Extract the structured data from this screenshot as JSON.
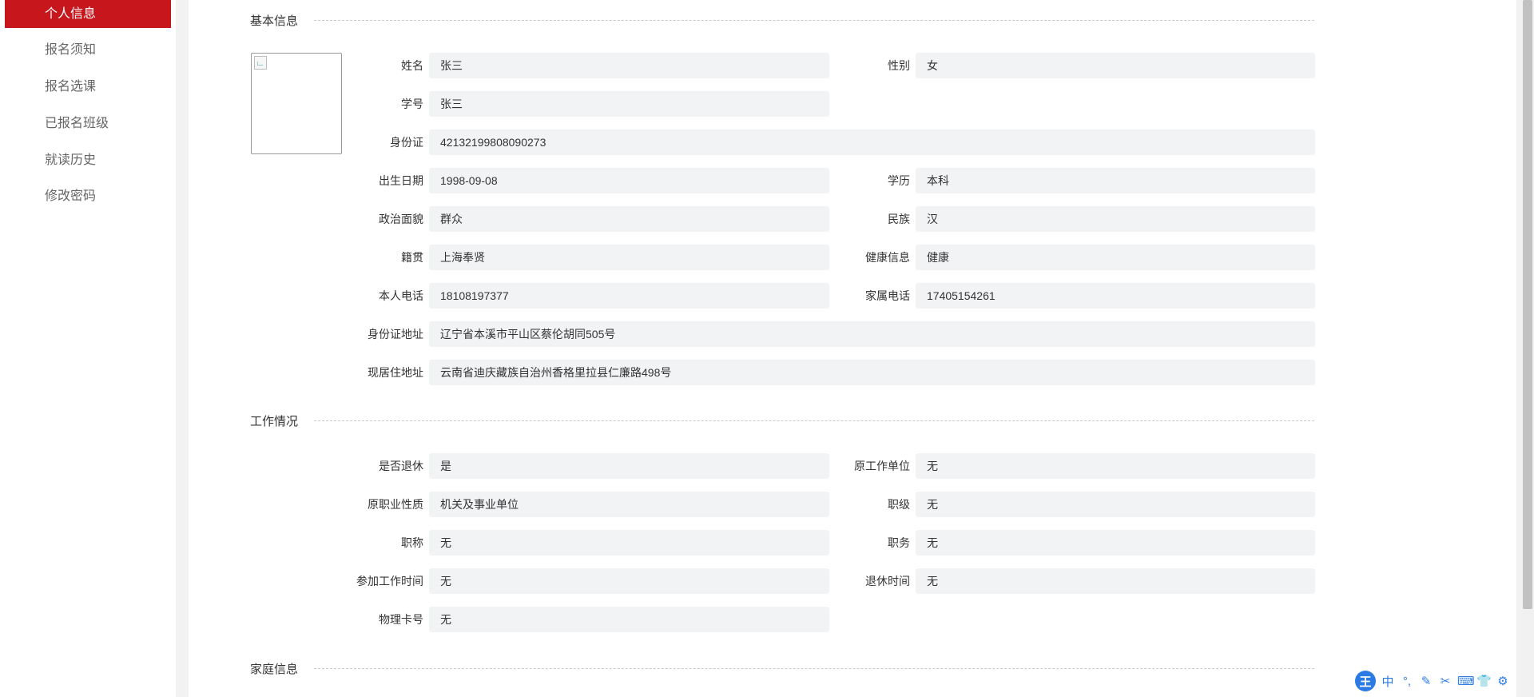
{
  "sidebar": {
    "items": [
      {
        "label": "个人信息",
        "active": true
      },
      {
        "label": "报名须知",
        "active": false
      },
      {
        "label": "报名选课",
        "active": false
      },
      {
        "label": "已报名班级",
        "active": false
      },
      {
        "label": "就读历史",
        "active": false
      },
      {
        "label": "修改密码",
        "active": false
      }
    ]
  },
  "sections": {
    "basic": "基本信息",
    "work": "工作情况",
    "family": "家庭信息"
  },
  "basic": {
    "name": {
      "label": "姓名",
      "value": "张三"
    },
    "gender": {
      "label": "性别",
      "value": "女"
    },
    "student_id": {
      "label": "学号",
      "value": "张三"
    },
    "id_card": {
      "label": "身份证",
      "value": "42132199808090273"
    },
    "birth": {
      "label": "出生日期",
      "value": "1998-09-08"
    },
    "education": {
      "label": "学历",
      "value": "本科"
    },
    "political": {
      "label": "政治面貌",
      "value": "群众"
    },
    "ethnicity": {
      "label": "民族",
      "value": "汉"
    },
    "native_place": {
      "label": "籍贯",
      "value": "上海奉贤"
    },
    "health": {
      "label": "健康信息",
      "value": "健康"
    },
    "phone": {
      "label": "本人电话",
      "value": "18108197377"
    },
    "family_phone": {
      "label": "家属电话",
      "value": "17405154261"
    },
    "id_address": {
      "label": "身份证地址",
      "value": "辽宁省本溪市平山区蔡伦胡同505号"
    },
    "current_address": {
      "label": "现居住地址",
      "value": "云南省迪庆藏族自治州香格里拉县仁廉路498号"
    }
  },
  "work": {
    "retired": {
      "label": "是否退休",
      "value": "是"
    },
    "former_unit": {
      "label": "原工作单位",
      "value": "无"
    },
    "occupation_nature": {
      "label": "原职业性质",
      "value": "机关及事业单位"
    },
    "rank": {
      "label": "职级",
      "value": "无"
    },
    "title": {
      "label": "职称",
      "value": "无"
    },
    "position": {
      "label": "职务",
      "value": "无"
    },
    "work_start": {
      "label": "参加工作时间",
      "value": "无"
    },
    "retire_time": {
      "label": "退休时间",
      "value": "无"
    },
    "card_no": {
      "label": "物理卡号",
      "value": "无"
    }
  },
  "ime": {
    "logo": "王",
    "mode": "中",
    "punct": "°,",
    "icons": [
      "pen-icon",
      "scissors-icon",
      "keyboard-icon",
      "shirt-icon",
      "gear-icon"
    ]
  }
}
